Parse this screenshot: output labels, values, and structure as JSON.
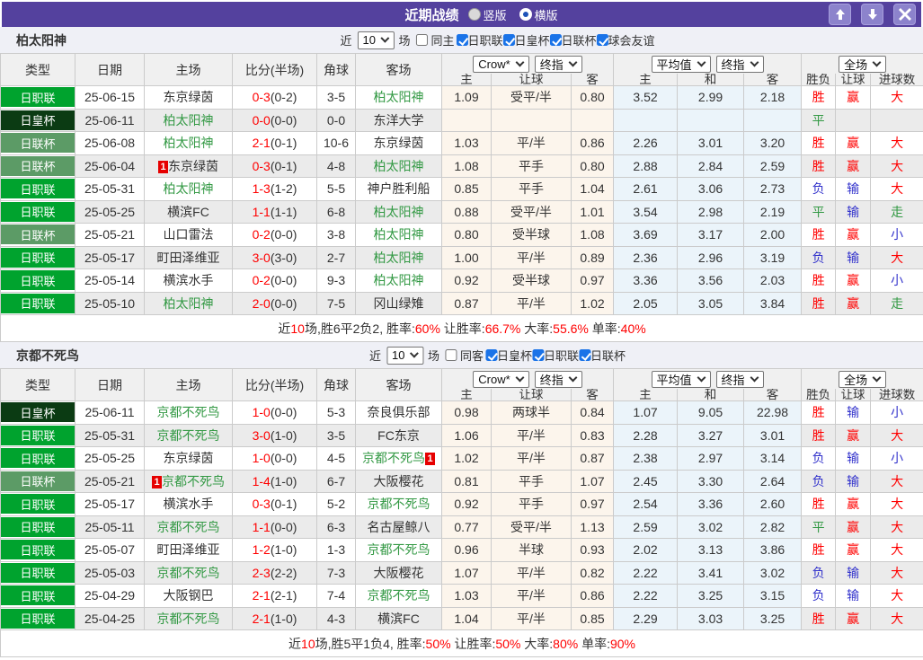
{
  "titlebar": {
    "title": "近期战绩",
    "layout_options": [
      {
        "label": "竖版",
        "selected": false
      },
      {
        "label": "横版",
        "selected": true
      }
    ]
  },
  "columns": {
    "type": "类型",
    "date": "日期",
    "home": "主场",
    "score": "比分(半场)",
    "corner": "角球",
    "away": "客场",
    "odds_group": {
      "source": "Crow*",
      "stage": "终指",
      "cols": [
        "主",
        "让球",
        "客"
      ]
    },
    "avg_group": {
      "source": "平均值",
      "stage": "终指",
      "cols": [
        "主",
        "和",
        "客"
      ]
    },
    "result_group": {
      "scope": "全场",
      "cols": [
        "胜负",
        "让球",
        "进球数"
      ]
    }
  },
  "type_colors": {
    "日职联": "#00a32e",
    "日皇杯": "#0b3b13",
    "日联杯": "#5c9b66"
  },
  "sections": [
    {
      "team": "柏太阳神",
      "filter": {
        "recent": "近",
        "count": "10",
        "unit": "场",
        "same": "同主",
        "same_checked": false,
        "leagues": [
          {
            "label": "日职联",
            "checked": true
          },
          {
            "label": "日皇杯",
            "checked": true
          },
          {
            "label": "日联杯",
            "checked": true
          },
          {
            "label": "球会友谊",
            "checked": true
          }
        ]
      },
      "rows": [
        {
          "type": "日职联",
          "date": "25-06-15",
          "home": {
            "name": "东京绿茵",
            "focus": false
          },
          "score": "0-3",
          "half": "(0-2)",
          "corner": "3-5",
          "away": {
            "name": "柏太阳神",
            "focus": true
          },
          "odds": [
            "1.09",
            "受平/半",
            "0.80"
          ],
          "avg": [
            "3.52",
            "2.99",
            "2.18"
          ],
          "results": [
            "胜",
            "赢",
            "大"
          ]
        },
        {
          "type": "日皇杯",
          "date": "25-06-11",
          "home": {
            "name": "柏太阳神",
            "focus": true
          },
          "score": "0-0",
          "half": "(0-0)",
          "corner": "0-0",
          "away": {
            "name": "东洋大学",
            "focus": false
          },
          "odds": [
            "",
            "",
            ""
          ],
          "avg": [
            "",
            "",
            ""
          ],
          "results": [
            "平",
            "",
            ""
          ]
        },
        {
          "type": "日联杯",
          "date": "25-06-08",
          "home": {
            "name": "柏太阳神",
            "focus": true
          },
          "score": "2-1",
          "half": "(0-1)",
          "corner": "10-6",
          "away": {
            "name": "东京绿茵",
            "focus": false
          },
          "odds": [
            "1.03",
            "平/半",
            "0.86"
          ],
          "avg": [
            "2.26",
            "3.01",
            "3.20"
          ],
          "results": [
            "胜",
            "赢",
            "大"
          ]
        },
        {
          "type": "日联杯",
          "date": "25-06-04",
          "home": {
            "name": "东京绿茵",
            "focus": false,
            "badge": "1",
            "badge_pos": "before"
          },
          "score": "0-3",
          "half": "(0-1)",
          "corner": "4-8",
          "away": {
            "name": "柏太阳神",
            "focus": true
          },
          "odds": [
            "1.08",
            "平手",
            "0.80"
          ],
          "avg": [
            "2.88",
            "2.84",
            "2.59"
          ],
          "results": [
            "胜",
            "赢",
            "大"
          ]
        },
        {
          "type": "日职联",
          "date": "25-05-31",
          "home": {
            "name": "柏太阳神",
            "focus": true
          },
          "score": "1-3",
          "half": "(1-2)",
          "corner": "5-5",
          "away": {
            "name": "神户胜利船",
            "focus": false
          },
          "odds": [
            "0.85",
            "平手",
            "1.04"
          ],
          "avg": [
            "2.61",
            "3.06",
            "2.73"
          ],
          "results": [
            "负",
            "输",
            "大"
          ]
        },
        {
          "type": "日职联",
          "date": "25-05-25",
          "home": {
            "name": "横滨FC",
            "focus": false
          },
          "score": "1-1",
          "half": "(1-1)",
          "corner": "6-8",
          "away": {
            "name": "柏太阳神",
            "focus": true
          },
          "odds": [
            "0.88",
            "受平/半",
            "1.01"
          ],
          "avg": [
            "3.54",
            "2.98",
            "2.19"
          ],
          "results": [
            "平",
            "输",
            "走"
          ]
        },
        {
          "type": "日联杯",
          "date": "25-05-21",
          "home": {
            "name": "山口雷法",
            "focus": false
          },
          "score": "0-2",
          "half": "(0-0)",
          "corner": "3-8",
          "away": {
            "name": "柏太阳神",
            "focus": true
          },
          "odds": [
            "0.80",
            "受半球",
            "1.08"
          ],
          "avg": [
            "3.69",
            "3.17",
            "2.00"
          ],
          "results": [
            "胜",
            "赢",
            "小"
          ]
        },
        {
          "type": "日职联",
          "date": "25-05-17",
          "home": {
            "name": "町田泽维亚",
            "focus": false
          },
          "score": "3-0",
          "half": "(3-0)",
          "corner": "2-7",
          "away": {
            "name": "柏太阳神",
            "focus": true
          },
          "odds": [
            "1.00",
            "平/半",
            "0.89"
          ],
          "avg": [
            "2.36",
            "2.96",
            "3.19"
          ],
          "results": [
            "负",
            "输",
            "大"
          ]
        },
        {
          "type": "日职联",
          "date": "25-05-14",
          "home": {
            "name": "横滨水手",
            "focus": false
          },
          "score": "0-2",
          "half": "(0-0)",
          "corner": "9-3",
          "away": {
            "name": "柏太阳神",
            "focus": true
          },
          "odds": [
            "0.92",
            "受半球",
            "0.97"
          ],
          "avg": [
            "3.36",
            "3.56",
            "2.03"
          ],
          "results": [
            "胜",
            "赢",
            "小"
          ]
        },
        {
          "type": "日职联",
          "date": "25-05-10",
          "home": {
            "name": "柏太阳神",
            "focus": true
          },
          "score": "2-0",
          "half": "(0-0)",
          "corner": "7-5",
          "away": {
            "name": "冈山绿雉",
            "focus": false
          },
          "odds": [
            "0.87",
            "平/半",
            "1.02"
          ],
          "avg": [
            "2.05",
            "3.05",
            "3.84"
          ],
          "results": [
            "胜",
            "赢",
            "走"
          ]
        }
      ],
      "summary": [
        {
          "t": "近",
          "red": false
        },
        {
          "t": "10",
          "red": true
        },
        {
          "t": "场,胜6平2负2, 胜率:",
          "red": false
        },
        {
          "t": "60%",
          "red": true
        },
        {
          "t": " 让胜率:",
          "red": false
        },
        {
          "t": "66.7%",
          "red": true
        },
        {
          "t": " 大率:",
          "red": false
        },
        {
          "t": "55.6%",
          "red": true
        },
        {
          "t": " 单率:",
          "red": false
        },
        {
          "t": "40%",
          "red": true
        }
      ]
    },
    {
      "team": "京都不死鸟",
      "filter": {
        "recent": "近",
        "count": "10",
        "unit": "场",
        "same": "同客",
        "same_checked": false,
        "leagues": [
          {
            "label": "日皇杯",
            "checked": true
          },
          {
            "label": "日职联",
            "checked": true
          },
          {
            "label": "日联杯",
            "checked": true
          }
        ]
      },
      "rows": [
        {
          "type": "日皇杯",
          "date": "25-06-11",
          "home": {
            "name": "京都不死鸟",
            "focus": true
          },
          "score": "1-0",
          "half": "(0-0)",
          "corner": "5-3",
          "away": {
            "name": "奈良俱乐部",
            "focus": false
          },
          "odds": [
            "0.98",
            "两球半",
            "0.84"
          ],
          "avg": [
            "1.07",
            "9.05",
            "22.98"
          ],
          "results": [
            "胜",
            "输",
            "小"
          ]
        },
        {
          "type": "日职联",
          "date": "25-05-31",
          "home": {
            "name": "京都不死鸟",
            "focus": true
          },
          "score": "3-0",
          "half": "(1-0)",
          "corner": "3-5",
          "away": {
            "name": "FC东京",
            "focus": false
          },
          "odds": [
            "1.06",
            "平/半",
            "0.83"
          ],
          "avg": [
            "2.28",
            "3.27",
            "3.01"
          ],
          "results": [
            "胜",
            "赢",
            "大"
          ]
        },
        {
          "type": "日职联",
          "date": "25-05-25",
          "home": {
            "name": "东京绿茵",
            "focus": false
          },
          "score": "1-0",
          "half": "(0-0)",
          "corner": "4-5",
          "away": {
            "name": "京都不死鸟",
            "focus": true,
            "badge": "1",
            "badge_pos": "after"
          },
          "odds": [
            "1.02",
            "平/半",
            "0.87"
          ],
          "avg": [
            "2.38",
            "2.97",
            "3.14"
          ],
          "results": [
            "负",
            "输",
            "小"
          ]
        },
        {
          "type": "日联杯",
          "date": "25-05-21",
          "home": {
            "name": "京都不死鸟",
            "focus": true,
            "badge": "1",
            "badge_pos": "before"
          },
          "score": "1-4",
          "half": "(1-0)",
          "corner": "6-7",
          "away": {
            "name": "大阪樱花",
            "focus": false
          },
          "odds": [
            "0.81",
            "平手",
            "1.07"
          ],
          "avg": [
            "2.45",
            "3.30",
            "2.64"
          ],
          "results": [
            "负",
            "输",
            "大"
          ]
        },
        {
          "type": "日职联",
          "date": "25-05-17",
          "home": {
            "name": "横滨水手",
            "focus": false
          },
          "score": "0-3",
          "half": "(0-1)",
          "corner": "5-2",
          "away": {
            "name": "京都不死鸟",
            "focus": true
          },
          "odds": [
            "0.92",
            "平手",
            "0.97"
          ],
          "avg": [
            "2.54",
            "3.36",
            "2.60"
          ],
          "results": [
            "胜",
            "赢",
            "大"
          ]
        },
        {
          "type": "日职联",
          "date": "25-05-11",
          "home": {
            "name": "京都不死鸟",
            "focus": true
          },
          "score": "1-1",
          "half": "(0-0)",
          "corner": "6-3",
          "away": {
            "name": "名古屋鲸八",
            "focus": false
          },
          "odds": [
            "0.77",
            "受平/半",
            "1.13"
          ],
          "avg": [
            "2.59",
            "3.02",
            "2.82"
          ],
          "results": [
            "平",
            "赢",
            "大"
          ]
        },
        {
          "type": "日职联",
          "date": "25-05-07",
          "home": {
            "name": "町田泽维亚",
            "focus": false
          },
          "score": "1-2",
          "half": "(1-0)",
          "corner": "1-3",
          "away": {
            "name": "京都不死鸟",
            "focus": true
          },
          "odds": [
            "0.96",
            "半球",
            "0.93"
          ],
          "avg": [
            "2.02",
            "3.13",
            "3.86"
          ],
          "results": [
            "胜",
            "赢",
            "大"
          ]
        },
        {
          "type": "日职联",
          "date": "25-05-03",
          "home": {
            "name": "京都不死鸟",
            "focus": true
          },
          "score": "2-3",
          "half": "(2-2)",
          "corner": "7-3",
          "away": {
            "name": "大阪樱花",
            "focus": false
          },
          "odds": [
            "1.07",
            "平/半",
            "0.82"
          ],
          "avg": [
            "2.22",
            "3.41",
            "3.02"
          ],
          "results": [
            "负",
            "输",
            "大"
          ]
        },
        {
          "type": "日职联",
          "date": "25-04-29",
          "home": {
            "name": "大阪钢巴",
            "focus": false
          },
          "score": "2-1",
          "half": "(2-1)",
          "corner": "7-4",
          "away": {
            "name": "京都不死鸟",
            "focus": true
          },
          "odds": [
            "1.03",
            "平/半",
            "0.86"
          ],
          "avg": [
            "2.22",
            "3.25",
            "3.15"
          ],
          "results": [
            "负",
            "输",
            "大"
          ]
        },
        {
          "type": "日职联",
          "date": "25-04-25",
          "home": {
            "name": "京都不死鸟",
            "focus": true
          },
          "score": "2-1",
          "half": "(1-0)",
          "corner": "4-3",
          "away": {
            "name": "横滨FC",
            "focus": false
          },
          "odds": [
            "1.04",
            "平/半",
            "0.85"
          ],
          "avg": [
            "2.29",
            "3.03",
            "3.25"
          ],
          "results": [
            "胜",
            "赢",
            "大"
          ]
        }
      ],
      "summary": [
        {
          "t": "近",
          "red": false
        },
        {
          "t": "10",
          "red": true
        },
        {
          "t": "场,胜5平1负4, 胜率:",
          "red": false
        },
        {
          "t": "50%",
          "red": true
        },
        {
          "t": " 让胜率:",
          "red": false
        },
        {
          "t": "50%",
          "red": true
        },
        {
          "t": " 大率:",
          "red": false
        },
        {
          "t": "80%",
          "red": true
        },
        {
          "t": " 单率:",
          "red": false
        },
        {
          "t": "90%",
          "red": true
        }
      ]
    }
  ]
}
